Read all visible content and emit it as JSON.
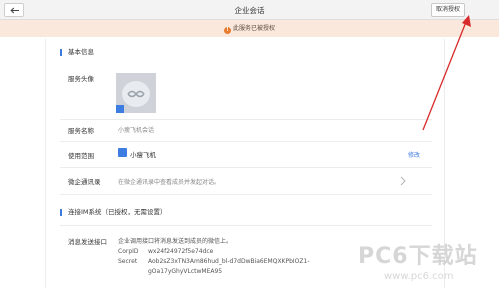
{
  "header": {
    "title": "企业会话",
    "revoke_label": "取消授权"
  },
  "notice": {
    "text": "此服务已被授权"
  },
  "section_basic": {
    "heading": "基本信息",
    "avatar_label": "服务头像",
    "name_label": "服务名称",
    "name_value": "小瘦飞机会话",
    "scope_label": "使用范围",
    "scope_value": "小瘦飞机",
    "edit_label": "修改",
    "wecom_label": "微企通讯录",
    "wecom_value": "在微企通讯录中查看成员并发起对话。"
  },
  "section_im": {
    "heading": "连接IM系统（已授权，无需设置）",
    "endpoint_label": "消息发送接口",
    "endpoint_desc": "企业调用接口将消息发送到成员的微信上。",
    "corpid_key": "CorpID",
    "corpid_value": "wx24f24972f5e74dce",
    "secret_key": "Secret",
    "secret_value_1": "Aob2sZ3xTN3Am86hud_bl-d7dDwBia6EMQXKPbIOZ1-",
    "secret_value_2": "gOa17yGhyVLctwMEA95"
  },
  "watermark": {
    "brand": "PC6下载站",
    "url": "www.pc6.com"
  },
  "colors": {
    "accent": "#3d7de2",
    "notice_bg": "#fbe8dc",
    "warning": "#e87b2d",
    "arrow": "#d82a2a"
  },
  "icons": {
    "back": "arrow-left-icon",
    "warning": "warning-circle-icon",
    "scope": "folder-icon",
    "chevron": "chevron-right-icon"
  }
}
